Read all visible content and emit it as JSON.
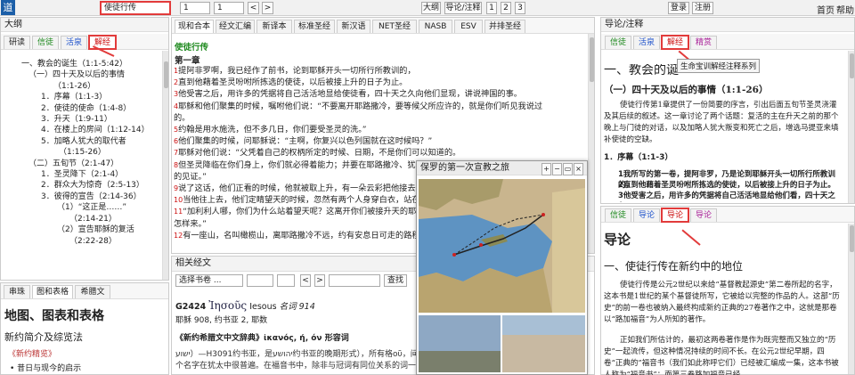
{
  "app": {
    "logo": "道",
    "search_value": "使徒行传",
    "chapter_select": "1",
    "verse_select": "1",
    "prev": "<",
    "next": ">",
    "btn_outline": "大纲",
    "btn_guide": "导论/注释",
    "pages": [
      "1",
      "2",
      "3"
    ],
    "login": "登录",
    "register": "注册",
    "home": "首页",
    "help": "帮助"
  },
  "left": {
    "title": "大纲",
    "tabs": [
      "研读",
      "信徒",
      "活泉",
      "解经"
    ],
    "outline": [
      "一、教会的诞生（1:1-5:42）",
      "（一）四十天及以后的事情",
      "（1:1-26）",
      "1．序幕（1:1-3）",
      "2．使徒的使命（1:4-8）",
      "3．升天（1:9-11）",
      "4．在楼上的房间（1:12-14）",
      "5．加略人犹大的取代者",
      "（1:15-26）",
      "（二）五旬节（2:1-47）",
      "1．圣灵降下（2:1-4）",
      "2．群众大为惊奇（2:5-13）",
      "3．彼得的宣告（2:14-36）",
      "（1）“这正是……”",
      "（2:14-21）",
      "（2）宣告耶稣的复活",
      "（2:22-28）"
    ],
    "tabs2": [
      "串珠",
      "图和表格",
      "希腊文"
    ],
    "bottom_title": "地图、图表和表格",
    "bottom_sub": "新约简介及综览法",
    "bottom_link": "《新约精览》",
    "bottom_item": "昔日与现今的启示"
  },
  "center": {
    "tabs": [
      "现和合本",
      "经文汇编",
      "新译本",
      "标准圣经",
      "新汉语",
      "NET圣经",
      "NASB",
      "ESV",
      "并排圣经"
    ],
    "book": "使徒行传",
    "chapter": "第一章",
    "verses": [
      [
        "1",
        "提阿非罗啊，我已经作了前书，论到耶稣开头一切所行所教训的，"
      ],
      [
        "2",
        "直到他藉着圣灵吩咐所拣选的使徒，以后被接上升的日子为止。"
      ],
      [
        "3",
        "他受害之后，用许多的凭据将自己活活地显给使徒看，四十天之久向他们显现，讲说神国的事。"
      ],
      [
        "4",
        "耶稣和他们聚集的时候，嘱咐他们说：“不要离开耶路撒冷，要等候父所应许的，就是你们听见我说过"
      ],
      [
        "",
        "的。"
      ],
      [
        "5",
        "约翰是用水施洗，但不多几日，你们要受圣灵的洗。”"
      ],
      [
        "6",
        "他们聚集的时候，问耶稣说：“主啊，你复兴以色列国就在这时候吗？”"
      ],
      [
        "7",
        "耶稣对他们说：“父凭着自己的权柄所定的时候、日期，不是你们可以知道的。"
      ],
      [
        "8",
        "但圣灵降临在你们身上，你们就必得着能力；并要在耶路撒冷、犹太全地，和撒马利亚，直到地极，作我"
      ],
      [
        "",
        "的见证。”"
      ],
      [
        "9",
        "说了这话，他们正看的时候，他就被取上升，有一朵云彩把他接去，便看不见他了。"
      ],
      [
        "10",
        "当他往上去，他们定睛望天的时候，忽然有两个人身穿白衣，站在旁边，"
      ],
      [
        "11",
        "“加利利人哪，你们为什么站着望天呢？这离开你们被接升天的耶稣，你们见他怎样往天上去，他还要"
      ],
      [
        "",
        "怎样来。”"
      ],
      [
        "12",
        "有一座山，名叫橄榄山，离耶路撒冷不远，约有安息日可走的路程。"
      ]
    ],
    "related_title": "相关经文",
    "related_select": "选择书卷 ...",
    "related_search": "查找",
    "lex_code": "G2424",
    "lex_word": "Ἰησοῦς",
    "lex_translit": "Iesous",
    "lex_info": "名词 914",
    "lex_count": "耶稣 908, 约书亚 2, 耶数",
    "lex_dict": "《新约希腊文中文辞典》ἰκανός, ή, όν 形容词",
    "lex_body": "ישוע）—H3091约书亚，是יהושע约书亚的晚期形式），所有格οῦ，间接受格οῦ，直接受格οῦν，呼格οῦ，0耶稣。这个名字在犹太中很普遍。在福音书中，除非与冠词有同位关系的词一起出现外，否则常具有已知的冠词，在书信和"
  },
  "map_popup": {
    "title": "保罗的第一次宣教之旅",
    "controls": [
      "+",
      "−",
      "▭",
      "×"
    ]
  },
  "right": {
    "title": "导论/注释",
    "tabs": [
      "信徒",
      "活泉",
      "解经",
      "精赏"
    ],
    "tooltip": "生命宝训解经注释系列",
    "h1": "一、教会的诞生（1:1-5:42）",
    "h2": "（一）四十天及以后的事情（1:1-26）",
    "p1": "使徒行传第1章提供了一份简要的序言，引出后面五旬节圣灵浇灌及其后续的叙述。这一章讨论了两个话题：复活的主在升天之前的那个晚上与门徒的对话，以及加略人犹大叛变和死亡之后，增选马提亚来填补使徒的空缺。",
    "list1": "1．序幕（1:1-3）",
    "v1": "1我所写的第一卷，提阿非罗，乃是论到耶稣开头一切所行所教训的，",
    "v2": "2直到他藉着圣灵吩咐所拣选的使徒，以后被接上升的日子为止。",
    "v3": "3他受害之后，用许多的凭据将自己活活地显给他们看，四十天之久",
    "tabs2": [
      "信徒",
      "导论",
      "导论",
      "导论"
    ],
    "intro_title": "导论",
    "intro_h": "一、使徒行传在新约中的地位",
    "intro_p1": "使徒行传是公元2世纪以来给“基督教起源史”第二卷所起的名字，这本书是1世纪的某个基督徒所写，它被给以完整的作品的人。这部“历史”的前一卷也被纳入最终构成新约正典的27卷著作之中，这就是那卷以“路加福音”为人所知的著作。",
    "intro_p2": "正如我们所估计的，最初这两卷著作是作为既完整而又独立的“历史”一起流传，但这种情况持续的时间不长。在公元2世纪早期，四卷“正典的”福音书（我们如此称呼它们）已经被汇编成一集，这本书被人称为“福音书”；而第三卷路加福音已经"
  }
}
